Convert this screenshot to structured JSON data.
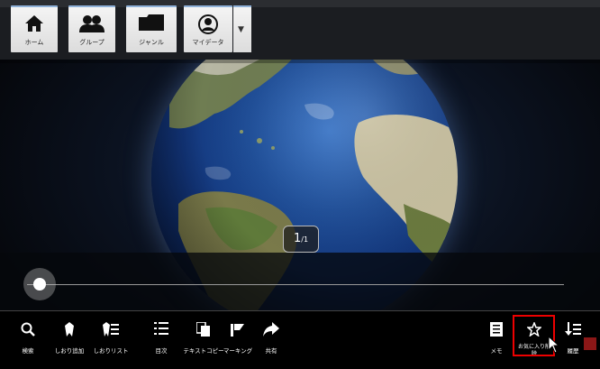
{
  "topnav": {
    "home": "ホーム",
    "group": "グループ",
    "genre": "ジャンル",
    "mydata": "マイデータ",
    "dropdown_icon": "▼"
  },
  "page_indicator": {
    "current": "1",
    "separator": "/",
    "total": "1"
  },
  "slider": {
    "position": 0.0
  },
  "toolbar": {
    "search": "検索",
    "add_bookmark": "しおり追加",
    "bookmark_list": "しおりリスト",
    "toc": "目次",
    "text_copy": "テキストコピー",
    "marking": "マーキング",
    "share": "共有",
    "memo": "メモ",
    "fav_remove": "お気に入り削除",
    "history": "履歴"
  },
  "colors": {
    "highlight": "#e00000",
    "nav_accent": "#8fb1d8"
  }
}
